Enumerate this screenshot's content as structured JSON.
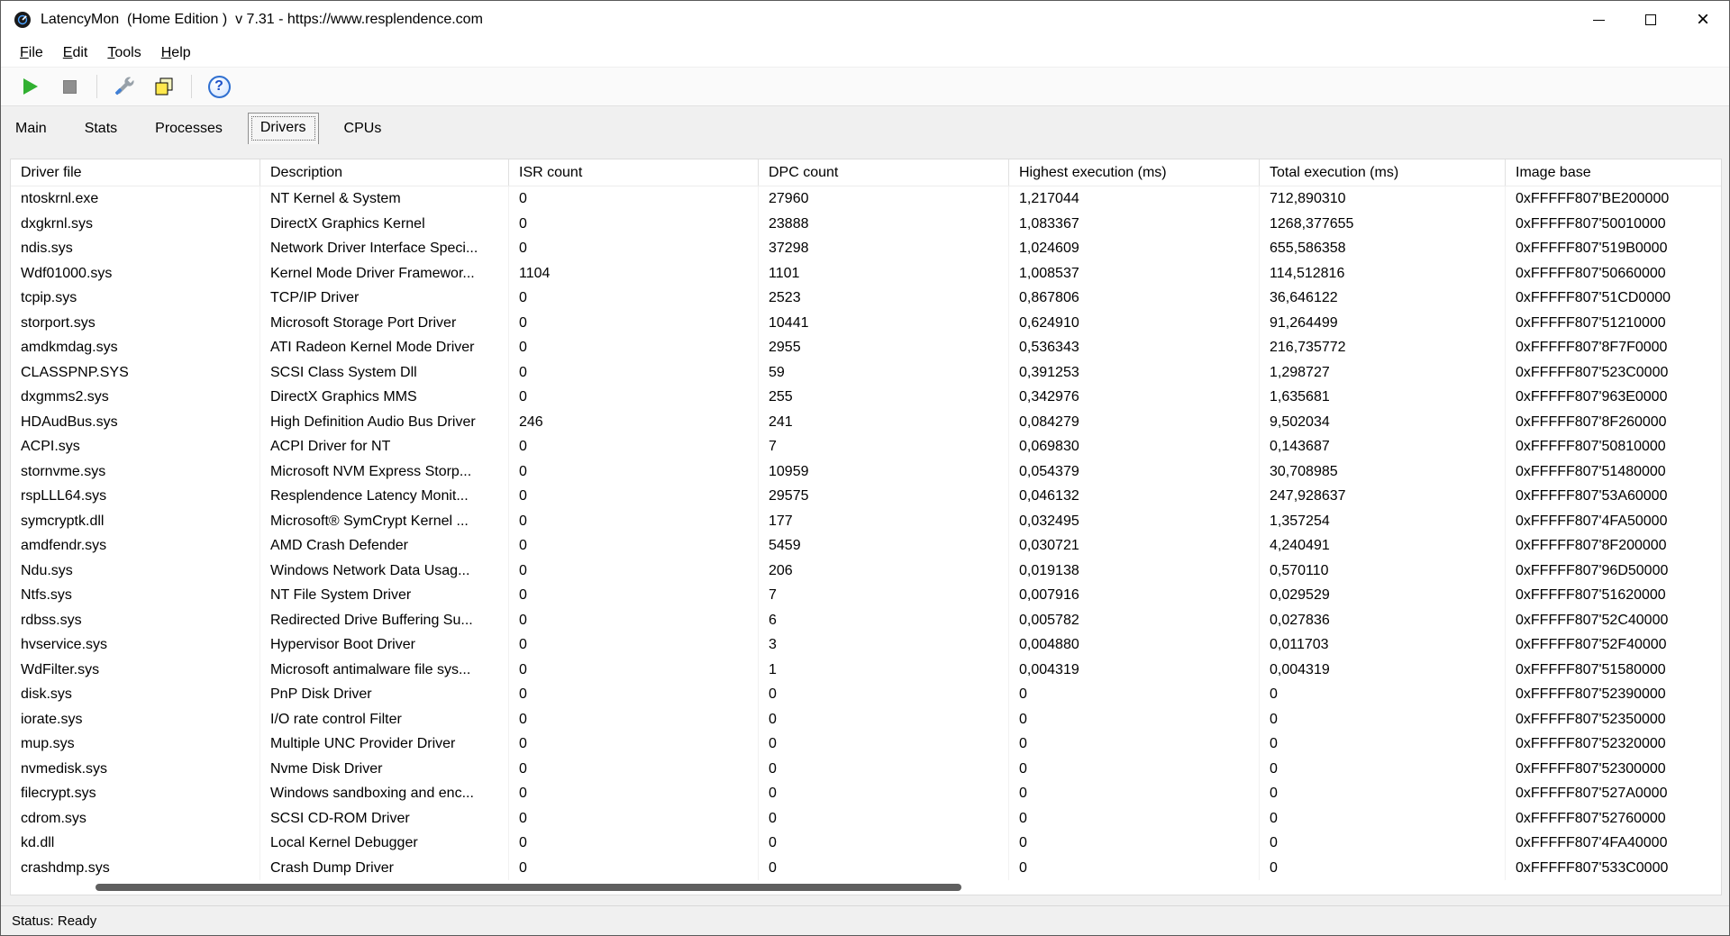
{
  "window": {
    "title": "LatencyMon  (Home Edition )  v 7.31 - https://www.resplendence.com",
    "controls": {
      "minimize": "minimize",
      "maximize": "maximize",
      "close": "close"
    }
  },
  "icons": {
    "app": "latencymon-gauge-logo",
    "play": "green-play-triangle",
    "stop": "gray-stop-square",
    "tools": "wrench-tools",
    "copy": "overlapping-pages-copy",
    "help": "?"
  },
  "colors": {
    "play_green": "#31b031",
    "help_blue": "#2f6fd0",
    "chrome_gray": "#f0f0f0",
    "scroll_thumb": "#5f5f5f"
  },
  "menu": {
    "items": [
      "File",
      "Edit",
      "Tools",
      "Help"
    ]
  },
  "tabs": {
    "items": [
      {
        "label": "Main",
        "active": false
      },
      {
        "label": "Stats",
        "active": false
      },
      {
        "label": "Processes",
        "active": false
      },
      {
        "label": "Drivers",
        "active": true
      },
      {
        "label": "CPUs",
        "active": false
      }
    ]
  },
  "table": {
    "columns": [
      "Driver file",
      "Description",
      "ISR count",
      "DPC count",
      "Highest execution (ms)",
      "Total execution (ms)",
      "Image base"
    ],
    "rows": [
      [
        "ntoskrnl.exe",
        "NT Kernel & System",
        "0",
        "27960",
        "1,217044",
        "712,890310",
        "0xFFFFF807'BE200000"
      ],
      [
        "dxgkrnl.sys",
        "DirectX Graphics Kernel",
        "0",
        "23888",
        "1,083367",
        "1268,377655",
        "0xFFFFF807'50010000"
      ],
      [
        "ndis.sys",
        "Network Driver Interface Speci...",
        "0",
        "37298",
        "1,024609",
        "655,586358",
        "0xFFFFF807'519B0000"
      ],
      [
        "Wdf01000.sys",
        "Kernel Mode Driver Framewor...",
        "1104",
        "1101",
        "1,008537",
        "114,512816",
        "0xFFFFF807'50660000"
      ],
      [
        "tcpip.sys",
        "TCP/IP Driver",
        "0",
        "2523",
        "0,867806",
        "36,646122",
        "0xFFFFF807'51CD0000"
      ],
      [
        "storport.sys",
        "Microsoft Storage Port Driver",
        "0",
        "10441",
        "0,624910",
        "91,264499",
        "0xFFFFF807'51210000"
      ],
      [
        "amdkmdag.sys",
        "ATI Radeon Kernel Mode Driver",
        "0",
        "2955",
        "0,536343",
        "216,735772",
        "0xFFFFF807'8F7F0000"
      ],
      [
        "CLASSPNP.SYS",
        "SCSI Class System Dll",
        "0",
        "59",
        "0,391253",
        "1,298727",
        "0xFFFFF807'523C0000"
      ],
      [
        "dxgmms2.sys",
        "DirectX Graphics MMS",
        "0",
        "255",
        "0,342976",
        "1,635681",
        "0xFFFFF807'963E0000"
      ],
      [
        "HDAudBus.sys",
        "High Definition Audio Bus Driver",
        "246",
        "241",
        "0,084279",
        "9,502034",
        "0xFFFFF807'8F260000"
      ],
      [
        "ACPI.sys",
        "ACPI Driver for NT",
        "0",
        "7",
        "0,069830",
        "0,143687",
        "0xFFFFF807'50810000"
      ],
      [
        "stornvme.sys",
        "Microsoft NVM Express Storp...",
        "0",
        "10959",
        "0,054379",
        "30,708985",
        "0xFFFFF807'51480000"
      ],
      [
        "rspLLL64.sys",
        "Resplendence Latency Monit...",
        "0",
        "29575",
        "0,046132",
        "247,928637",
        "0xFFFFF807'53A60000"
      ],
      [
        "symcryptk.dll",
        "Microsoft® SymCrypt Kernel ...",
        "0",
        "177",
        "0,032495",
        "1,357254",
        "0xFFFFF807'4FA50000"
      ],
      [
        "amdfendr.sys",
        "AMD Crash Defender",
        "0",
        "5459",
        "0,030721",
        "4,240491",
        "0xFFFFF807'8F200000"
      ],
      [
        "Ndu.sys",
        "Windows Network Data Usag...",
        "0",
        "206",
        "0,019138",
        "0,570110",
        "0xFFFFF807'96D50000"
      ],
      [
        "Ntfs.sys",
        "NT File System Driver",
        "0",
        "7",
        "0,007916",
        "0,029529",
        "0xFFFFF807'51620000"
      ],
      [
        "rdbss.sys",
        "Redirected Drive Buffering Su...",
        "0",
        "6",
        "0,005782",
        "0,027836",
        "0xFFFFF807'52C40000"
      ],
      [
        "hvservice.sys",
        "Hypervisor Boot Driver",
        "0",
        "3",
        "0,004880",
        "0,011703",
        "0xFFFFF807'52F40000"
      ],
      [
        "WdFilter.sys",
        "Microsoft antimalware file sys...",
        "0",
        "1",
        "0,004319",
        "0,004319",
        "0xFFFFF807'51580000"
      ],
      [
        "disk.sys",
        "PnP Disk Driver",
        "0",
        "0",
        "0",
        "0",
        "0xFFFFF807'52390000"
      ],
      [
        "iorate.sys",
        "I/O rate control Filter",
        "0",
        "0",
        "0",
        "0",
        "0xFFFFF807'52350000"
      ],
      [
        "mup.sys",
        "Multiple UNC Provider Driver",
        "0",
        "0",
        "0",
        "0",
        "0xFFFFF807'52320000"
      ],
      [
        "nvmedisk.sys",
        "Nvme Disk Driver",
        "0",
        "0",
        "0",
        "0",
        "0xFFFFF807'52300000"
      ],
      [
        "filecrypt.sys",
        "Windows sandboxing and enc...",
        "0",
        "0",
        "0",
        "0",
        "0xFFFFF807'527A0000"
      ],
      [
        "cdrom.sys",
        "SCSI CD-ROM Driver",
        "0",
        "0",
        "0",
        "0",
        "0xFFFFF807'52760000"
      ],
      [
        "kd.dll",
        "Local Kernel Debugger",
        "0",
        "0",
        "0",
        "0",
        "0xFFFFF807'4FA40000"
      ],
      [
        "crashdmp.sys",
        "Crash Dump Driver",
        "0",
        "0",
        "0",
        "0",
        "0xFFFFF807'533C0000"
      ]
    ]
  },
  "statusbar": {
    "text": "Status: Ready"
  }
}
